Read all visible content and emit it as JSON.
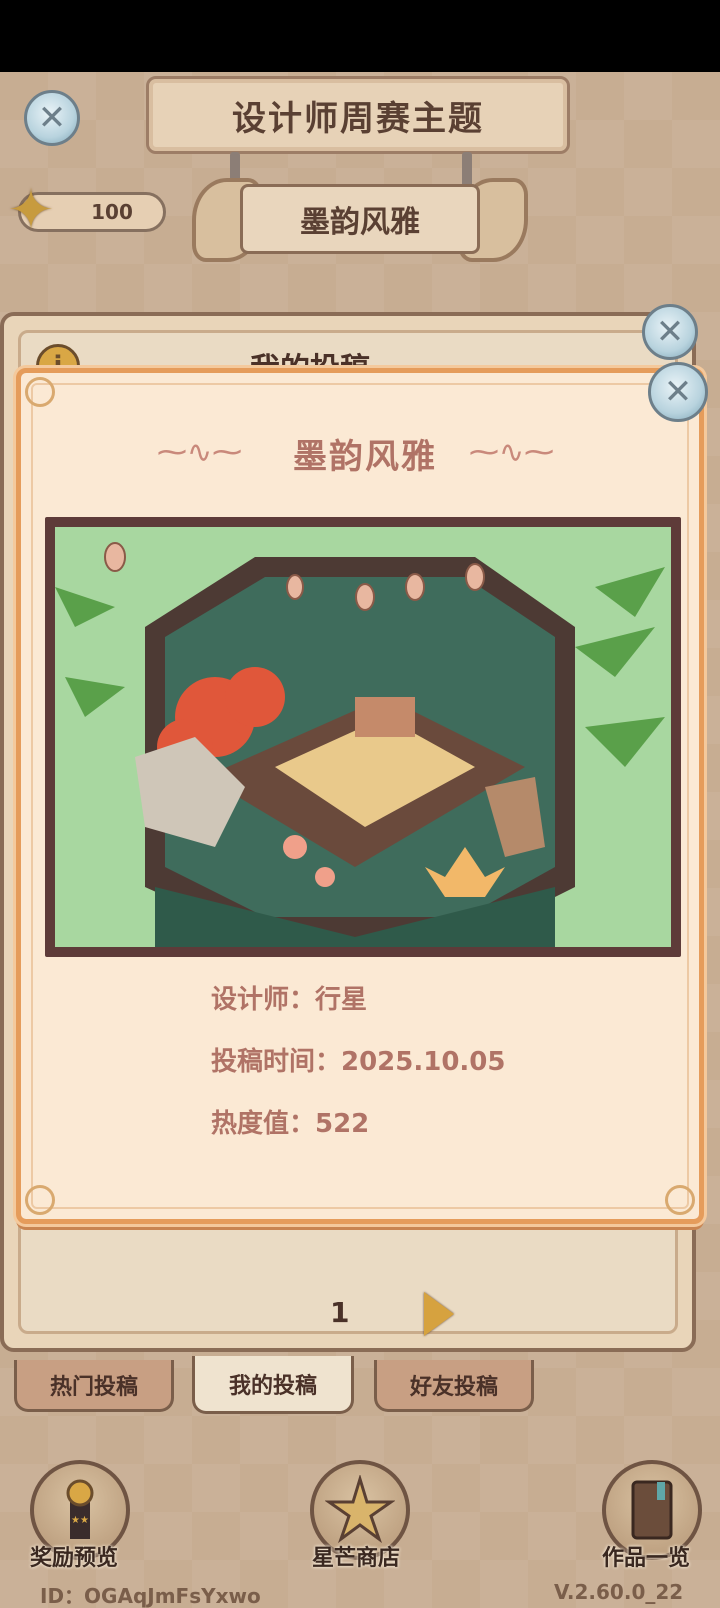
{
  "header": {
    "title": "设计师周赛主题",
    "theme_name": "墨韵风雅",
    "star_count": "100"
  },
  "back_panel": {
    "title": "我的投稿",
    "page_number": "1"
  },
  "tabs": [
    {
      "label": "热门投稿",
      "active": false
    },
    {
      "label": "我的投稿",
      "active": true
    },
    {
      "label": "好友投稿",
      "active": false
    }
  ],
  "bottom_bar": {
    "rewards_label": "奖励预览",
    "shop_label": "星芒商店",
    "works_label": "作品一览"
  },
  "footer": {
    "user_id": "ID：OGAqJmFsYxwo",
    "version": "V.2.60.0_22"
  },
  "modal": {
    "title": "墨韵风雅",
    "designer": "设计师：行星",
    "submit_time": "投稿时间：2025.10.05",
    "heat": "热度值：522"
  },
  "colors": {
    "modal_border": "#e59c5b",
    "modal_bg": "#fbe9d4",
    "accent_text": "#b07366"
  },
  "icons": [
    "close-icon",
    "star-icon",
    "info-icon",
    "next-arrow-icon",
    "trophy-icon",
    "book-icon"
  ]
}
